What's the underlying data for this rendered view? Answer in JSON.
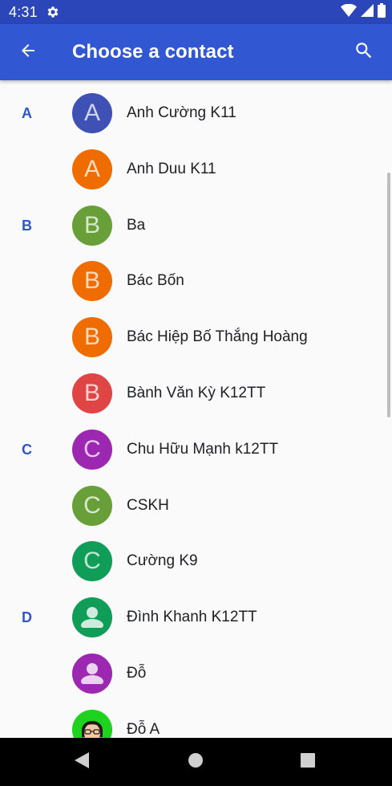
{
  "status_bar": {
    "time": "4:31",
    "icons": [
      "gear-icon",
      "wifi-icon",
      "signal-icon",
      "battery-icon"
    ]
  },
  "app_bar": {
    "title": "Choose a contact",
    "back_icon": "arrow-back-icon",
    "search_icon": "search-icon",
    "color": "#3158d2"
  },
  "contacts": [
    {
      "section": "A",
      "initial": "A",
      "name": "Anh Cường K11",
      "avatar_color": "#3f51b5",
      "avatar_type": "letter"
    },
    {
      "section": "",
      "initial": "A",
      "name": "Anh Duu K11",
      "avatar_color": "#ef6c00",
      "avatar_type": "letter"
    },
    {
      "section": "B",
      "initial": "B",
      "name": "Ba",
      "avatar_color": "#689f38",
      "avatar_type": "letter"
    },
    {
      "section": "",
      "initial": "B",
      "name": "Bác Bốn",
      "avatar_color": "#ef6c00",
      "avatar_type": "letter"
    },
    {
      "section": "",
      "initial": "B",
      "name": "Bác Hiệp Bố Thắng Hoàng",
      "avatar_color": "#ef6c00",
      "avatar_type": "letter"
    },
    {
      "section": "",
      "initial": "B",
      "name": "Bành Văn Kỳ K12TT",
      "avatar_color": "#e04545",
      "avatar_type": "letter"
    },
    {
      "section": "C",
      "initial": "C",
      "name": "Chu Hữu Mạnh k12TT",
      "avatar_color": "#9c27b0",
      "avatar_type": "letter"
    },
    {
      "section": "",
      "initial": "C",
      "name": "CSKH",
      "avatar_color": "#689f38",
      "avatar_type": "letter"
    },
    {
      "section": "",
      "initial": "C",
      "name": "Cường K9",
      "avatar_color": "#0f9d58",
      "avatar_type": "letter"
    },
    {
      "section": "D",
      "initial": "",
      "name": "Đình Khanh K12TT",
      "avatar_color": "#0f9d58",
      "avatar_type": "person"
    },
    {
      "section": "",
      "initial": "",
      "name": "Đỗ",
      "avatar_color": "#9c27b0",
      "avatar_type": "person"
    },
    {
      "section": "",
      "initial": "",
      "name": "Đỗ A",
      "avatar_color": "#1fd21f",
      "avatar_type": "photo"
    }
  ],
  "nav_bar": {
    "back_icon": "nav-back-icon",
    "home_icon": "nav-home-icon",
    "recents_icon": "nav-recents-icon"
  }
}
